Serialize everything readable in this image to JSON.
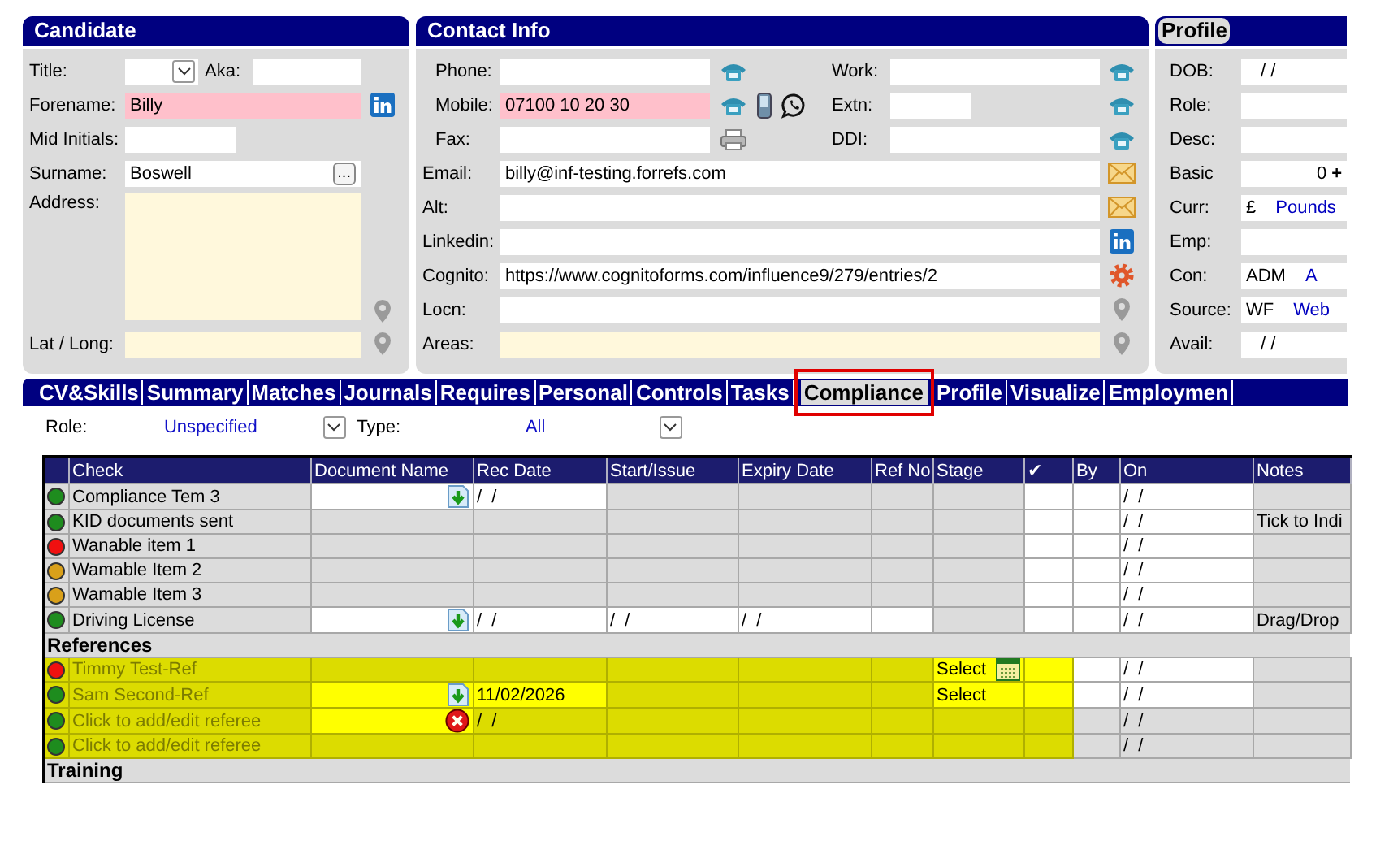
{
  "candidate": {
    "heading": "Candidate",
    "title": {
      "label": "Title:"
    },
    "aka": {
      "label": "Aka:"
    },
    "forename": {
      "label": "Forename:",
      "value": "Billy",
      "color": "#ffc0cb"
    },
    "mid_initials": {
      "label": "Mid Initials:"
    },
    "surname": {
      "label": "Surname:",
      "value": "Boswell",
      "button": "..."
    },
    "address": {
      "label": "Address:",
      "color": "#fff8dc"
    },
    "lat_long": {
      "label": "Lat / Long:",
      "color": "#fff8dc"
    }
  },
  "contact": {
    "heading": "Contact Info",
    "phone": {
      "label": "Phone:"
    },
    "work": {
      "label": "Work:"
    },
    "mobile": {
      "label": "Mobile:",
      "value": "07100 10 20 30",
      "color": "#ffc0cb"
    },
    "extn": {
      "label": "Extn:"
    },
    "fax": {
      "label": "Fax:"
    },
    "ddi": {
      "label": "DDI:"
    },
    "email": {
      "label": "Email:",
      "value": "billy@inf-testing.forrefs.com"
    },
    "alt": {
      "label": "Alt:"
    },
    "linkedin": {
      "label": "Linkedin:"
    },
    "cognito": {
      "label": "Cognito:",
      "value": "https://www.cognitoforms.com/influence9/279/entries/2"
    },
    "locn": {
      "label": "Locn:"
    },
    "areas": {
      "label": "Areas:",
      "color": "#fff8dc"
    }
  },
  "profile": {
    "heading": "Profile",
    "fields": [
      {
        "label": "DOB:",
        "value": "/  /",
        "kind": "date"
      },
      {
        "label": "Role:",
        "kind": "text"
      },
      {
        "label": "Desc:",
        "kind": "text"
      },
      {
        "label": "Basic",
        "value": "0",
        "suffix": "+",
        "kind": "number"
      },
      {
        "label": "Curr:",
        "value": "£",
        "extra": "Pounds",
        "kind": "lookup"
      },
      {
        "label": "Emp:",
        "kind": "text"
      },
      {
        "label": "Con:",
        "value": "ADM",
        "extra": "A",
        "kind": "lookup"
      },
      {
        "label": "Source:",
        "value": "WF",
        "extra": "Web",
        "kind": "lookup"
      },
      {
        "label": "Avail:",
        "value": "/  /",
        "kind": "date"
      }
    ]
  },
  "tabs": [
    {
      "label": "CV&Skills",
      "selected": false
    },
    {
      "label": "Summary",
      "selected": false
    },
    {
      "label": "Matches",
      "selected": false
    },
    {
      "label": "Journals",
      "selected": false
    },
    {
      "label": "Requires",
      "selected": false
    },
    {
      "label": "Personal",
      "selected": false
    },
    {
      "label": "Controls",
      "selected": false
    },
    {
      "label": "Tasks",
      "selected": false
    },
    {
      "label": "Compliance",
      "selected": true
    },
    {
      "label": "Profile",
      "selected": false
    },
    {
      "label": "Visualize",
      "selected": false
    },
    {
      "label": "Employmen",
      "selected": false
    }
  ],
  "filters": [
    {
      "label": "Role:",
      "value": "Unspecified"
    },
    {
      "label": "Type:",
      "value": "All"
    }
  ],
  "table": {
    "columns": [
      "Check",
      "Document Name",
      "Rec Date",
      "Start/Issue",
      "Expiry Date",
      "Ref No",
      "Stage",
      "✔",
      "By",
      "On",
      "Notes"
    ],
    "sections": [
      {
        "rows": [
          {
            "color": "#1e8c1e",
            "check": "Compliance Tem 3",
            "selected": false,
            "cells": [
              {
                "editable": true,
                "kind": "download"
              },
              {
                "text": "/  /",
                "editable": true
              },
              {
                "editable": false
              },
              {
                "editable": false
              },
              {
                "editable": false
              },
              {
                "editable": false
              },
              {
                "editable": true
              },
              {
                "editable": true
              },
              {
                "text": "/  /",
                "editable": true
              },
              {
                "editable": false
              }
            ]
          },
          {
            "color": "#1e8c1e",
            "check": "KID documents sent",
            "selected": false,
            "cells": [
              {
                "editable": false
              },
              {
                "editable": false
              },
              {
                "editable": false
              },
              {
                "editable": false
              },
              {
                "editable": false
              },
              {
                "editable": false
              },
              {
                "editable": true
              },
              {
                "editable": true
              },
              {
                "text": "/  /",
                "editable": true
              },
              {
                "text": "Tick to Indi",
                "editable": false
              }
            ]
          },
          {
            "color": "#f01010",
            "check": "Wanable item 1",
            "selected": false,
            "cells": [
              {
                "editable": false
              },
              {
                "editable": false
              },
              {
                "editable": false
              },
              {
                "editable": false
              },
              {
                "editable": false
              },
              {
                "editable": false
              },
              {
                "editable": true
              },
              {
                "editable": true
              },
              {
                "text": "/  /",
                "editable": true
              },
              {
                "editable": false
              }
            ]
          },
          {
            "color": "#d9a01a",
            "check": "Wamable Item 2",
            "selected": false,
            "cells": [
              {
                "editable": false
              },
              {
                "editable": false
              },
              {
                "editable": false
              },
              {
                "editable": false
              },
              {
                "editable": false
              },
              {
                "editable": false
              },
              {
                "editable": true
              },
              {
                "editable": true
              },
              {
                "text": "/  /",
                "editable": true
              },
              {
                "editable": false
              }
            ]
          },
          {
            "color": "#d9a01a",
            "check": "Wamable Item 3",
            "selected": false,
            "cells": [
              {
                "editable": false
              },
              {
                "editable": false
              },
              {
                "editable": false
              },
              {
                "editable": false
              },
              {
                "editable": false
              },
              {
                "editable": false
              },
              {
                "editable": true
              },
              {
                "editable": true
              },
              {
                "text": "/  /",
                "editable": true
              },
              {
                "editable": false
              }
            ]
          },
          {
            "color": "#1e8c1e",
            "check": "Driving License",
            "selected": false,
            "cells": [
              {
                "editable": true,
                "kind": "download"
              },
              {
                "text": "/  /",
                "editable": true
              },
              {
                "text": "/  /",
                "editable": true
              },
              {
                "text": "/  /",
                "editable": true
              },
              {
                "editable": true
              },
              {
                "editable": false
              },
              {
                "editable": true
              },
              {
                "editable": true
              },
              {
                "text": "/  /",
                "editable": true
              },
              {
                "text": "Drag/Drop",
                "editable": false
              }
            ]
          }
        ]
      },
      {
        "title": "References",
        "rows": [
          {
            "color": "#f01010",
            "check": "Timmy Test-Ref",
            "selected": true,
            "cells": [
              {
                "editable": false
              },
              {
                "editable": false
              },
              {
                "editable": false
              },
              {
                "editable": false
              },
              {
                "editable": false
              },
              {
                "text": "Select",
                "editable": true,
                "kind": "calendar"
              },
              {
                "editable": true
              },
              {
                "editable": true
              },
              {
                "text": "/  /",
                "editable": true
              },
              {
                "editable": false
              }
            ]
          },
          {
            "color": "#1e8c1e",
            "check": "Sam Second-Ref",
            "selected": true,
            "cells": [
              {
                "editable": true,
                "kind": "download"
              },
              {
                "text": "11/02/2026",
                "editable": true
              },
              {
                "editable": false
              },
              {
                "editable": false
              },
              {
                "editable": false
              },
              {
                "text": "Select",
                "editable": true
              },
              {
                "editable": true
              },
              {
                "editable": true
              },
              {
                "text": "/  /",
                "editable": true
              },
              {
                "editable": false
              }
            ]
          },
          {
            "color": "#1e8c1e",
            "check": "Click to add/edit referee",
            "selected": true,
            "cells": [
              {
                "editable": true,
                "kind": "error"
              },
              {
                "text": "/  /",
                "editable": false
              },
              {
                "editable": false
              },
              {
                "editable": false
              },
              {
                "editable": false
              },
              {
                "editable": false
              },
              {
                "editable": false
              },
              {
                "editable": false
              },
              {
                "text": "/  /",
                "editable": false
              },
              {
                "editable": false
              }
            ]
          },
          {
            "color": "#1e8c1e",
            "check": "Click to add/edit referee",
            "selected": true,
            "cells": [
              {
                "editable": false
              },
              {
                "editable": false
              },
              {
                "editable": false
              },
              {
                "editable": false
              },
              {
                "editable": false
              },
              {
                "editable": false
              },
              {
                "editable": false
              },
              {
                "editable": false
              },
              {
                "text": "/  /",
                "editable": false
              },
              {
                "editable": false
              }
            ]
          }
        ]
      },
      {
        "title": "Training"
      }
    ]
  }
}
